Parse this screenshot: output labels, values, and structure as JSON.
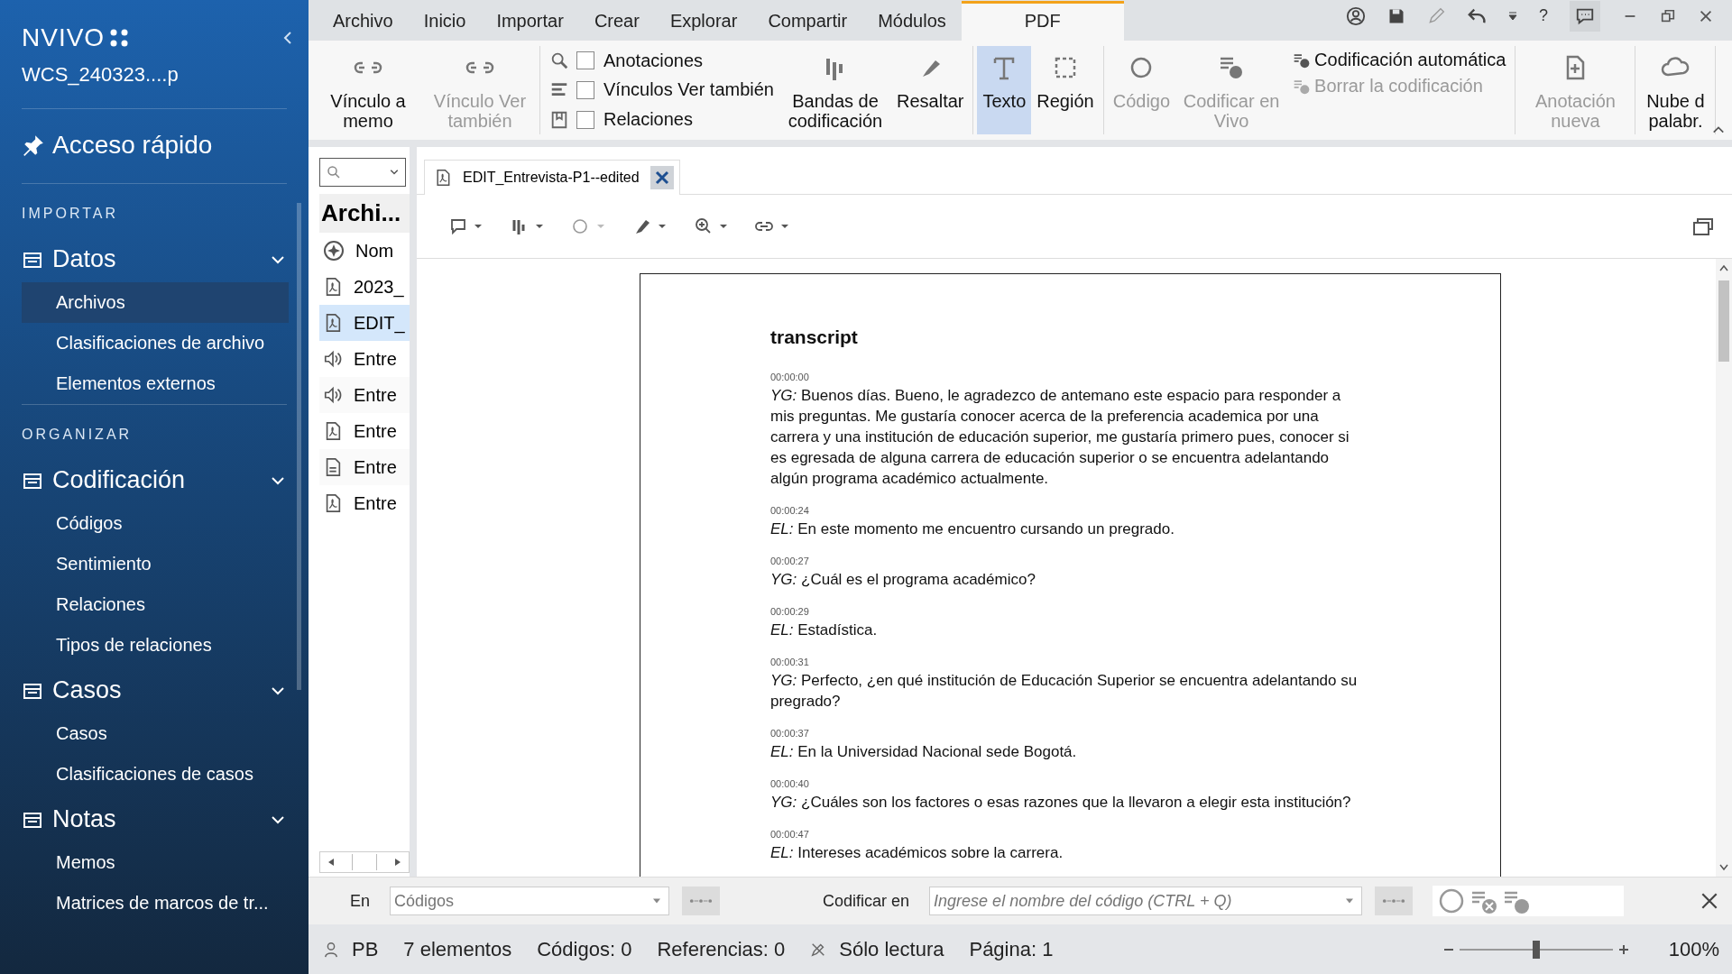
{
  "sidebar": {
    "app_name": "NVIVO",
    "project": "WCS_240323....p",
    "quick_access": "Acceso rápido",
    "sections": [
      {
        "heading": "IMPORTAR",
        "groups": [
          {
            "label": "Datos",
            "expanded": true,
            "items": [
              {
                "label": "Archivos",
                "selected": true
              },
              {
                "label": "Clasificaciones de archivo",
                "selected": false
              },
              {
                "label": "Elementos externos",
                "selected": false
              }
            ]
          }
        ]
      },
      {
        "heading": "ORGANIZAR",
        "groups": [
          {
            "label": "Codificación",
            "expanded": true,
            "items": [
              {
                "label": "Códigos",
                "selected": false
              },
              {
                "label": "Sentimiento",
                "selected": false
              },
              {
                "label": "Relaciones",
                "selected": false
              },
              {
                "label": "Tipos de relaciones",
                "selected": false
              }
            ]
          },
          {
            "label": "Casos",
            "expanded": true,
            "items": [
              {
                "label": "Casos",
                "selected": false
              },
              {
                "label": "Clasificaciones de casos",
                "selected": false
              }
            ]
          },
          {
            "label": "Notas",
            "expanded": true,
            "items": [
              {
                "label": "Memos",
                "selected": false
              },
              {
                "label": "Matrices de marcos de tr...",
                "selected": false
              }
            ]
          }
        ]
      }
    ]
  },
  "menu_tabs": [
    {
      "label": "Archivo",
      "selected": false
    },
    {
      "label": "Inicio",
      "selected": false
    },
    {
      "label": "Importar",
      "selected": false
    },
    {
      "label": "Crear",
      "selected": false
    },
    {
      "label": "Explorar",
      "selected": false
    },
    {
      "label": "Compartir",
      "selected": false
    },
    {
      "label": "Módulos",
      "selected": false
    },
    {
      "label": "PDF",
      "selected": true
    }
  ],
  "title_bar": {
    "help_label": "?"
  },
  "ribbon": {
    "groups": [
      {
        "items": [
          {
            "kind": "button",
            "label": "Vínculo a memo",
            "disabled": false,
            "selected": false
          },
          {
            "kind": "button",
            "label": "Vínculo Ver también",
            "disabled": true,
            "selected": false
          }
        ]
      },
      {
        "items": [
          {
            "kind": "checks",
            "options": [
              {
                "label": "Anotaciones",
                "checked": false
              },
              {
                "label": "Vínculos Ver también",
                "checked": false
              },
              {
                "label": "Relaciones",
                "checked": false
              }
            ]
          },
          {
            "kind": "button",
            "label": "Bandas de codificación",
            "disabled": false,
            "selected": false
          },
          {
            "kind": "button",
            "label": "Resaltar",
            "disabled": false,
            "selected": false
          }
        ]
      },
      {
        "items": [
          {
            "kind": "button",
            "label": "Texto",
            "disabled": false,
            "selected": true
          },
          {
            "kind": "button",
            "label": "Región",
            "disabled": false,
            "selected": false
          }
        ]
      },
      {
        "items": [
          {
            "kind": "button",
            "label": "Código",
            "disabled": true,
            "selected": false
          },
          {
            "kind": "button",
            "label": "Codificar en Vivo",
            "disabled": true,
            "selected": false
          },
          {
            "kind": "actions",
            "options": [
              {
                "label": "Codificación automática",
                "disabled": false
              },
              {
                "label": "Borrar la codificación",
                "disabled": true
              }
            ]
          }
        ]
      },
      {
        "items": [
          {
            "kind": "button",
            "label": "Anotación nueva",
            "disabled": true,
            "selected": false
          }
        ]
      },
      {
        "items": [
          {
            "kind": "button",
            "label": "Nube d palabr.",
            "disabled": false,
            "selected": false
          }
        ]
      }
    ]
  },
  "file_list": {
    "heading": "Archi...",
    "column_header": "Nom",
    "rows": [
      {
        "kind": "pdf",
        "label": "2023_",
        "selected": false
      },
      {
        "kind": "pdf",
        "label": "EDIT_",
        "selected": true
      },
      {
        "kind": "audio",
        "label": "Entre",
        "selected": false
      },
      {
        "kind": "audio",
        "label": "Entre",
        "selected": false
      },
      {
        "kind": "pdf",
        "label": "Entre",
        "selected": false
      },
      {
        "kind": "doc",
        "label": "Entre",
        "selected": false
      },
      {
        "kind": "pdf",
        "label": "Entre",
        "selected": false
      }
    ]
  },
  "document": {
    "tab": "EDIT_Entrevista-P1--edited",
    "title": "transcript",
    "entries": [
      {
        "time": "00:00:00",
        "text": "*YG:* Buenos días. Bueno, le agradezco de antemano este espacio para responder a mis preguntas. Me gustaría conocer acerca de la preferencia academica por una carrera y una institución de educación superior, me gustaría primero pues, conocer si es egresada de alguna carrera de educación superior o se encuentra adelantando algún programa académico actualmente."
      },
      {
        "time": "00:00:24",
        "text": "*EL:* En este momento me encuentro cursando un pregrado."
      },
      {
        "time": "00:00:27",
        "text": "*YG:* ¿Cuál es el programa académico?"
      },
      {
        "time": "00:00:29",
        "text": "*EL:* Estadística."
      },
      {
        "time": "00:00:31",
        "text": "*YG:* Perfecto, ¿en qué institución de Educación Superior se encuentra adelantando su pregrado?"
      },
      {
        "time": "00:00:37",
        "text": "*EL:* En la Universidad Nacional sede Bogotá."
      },
      {
        "time": "00:00:40",
        "text": "*YG:* ¿Cuáles son los factores o esas razones que la llevaron a elegir esta institución?"
      },
      {
        "time": "00:00:47",
        "text": "*EL:* Intereses académicos sobre la carrera."
      }
    ]
  },
  "code_bar": {
    "in_label": "En",
    "in_placeholder": "Códigos",
    "code_label": "Codificar en",
    "code_placeholder": "Ingrese el nombre del código (CTRL + Q)"
  },
  "status_bar": {
    "user": "PB",
    "items": "7 elementos",
    "codes": "Códigos: 0",
    "references": "Referencias: 0",
    "mode": "Sólo lectura",
    "page": "Página: 1",
    "zoom": {
      "level": 0.5
    },
    "zoom_reading": "100%"
  }
}
